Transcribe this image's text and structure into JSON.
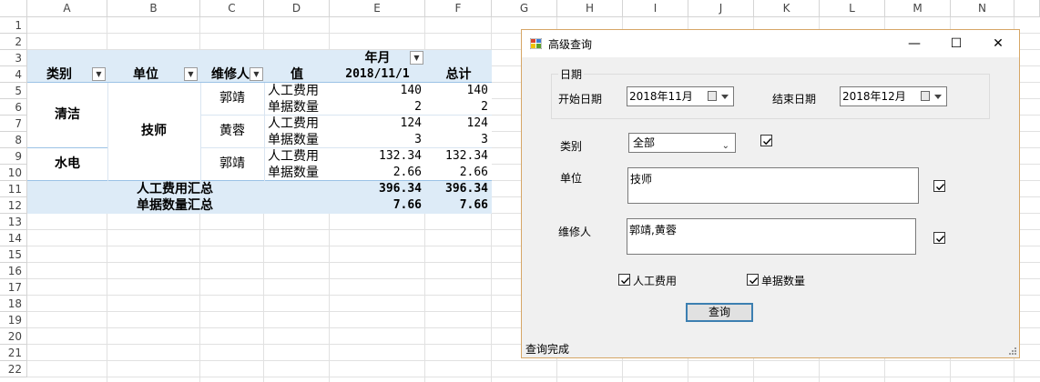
{
  "sheet": {
    "columns": [
      "A",
      "B",
      "C",
      "D",
      "E",
      "F",
      "G",
      "H",
      "I",
      "J",
      "K",
      "L",
      "M",
      "N"
    ],
    "rows": [
      "1",
      "2",
      "3",
      "4",
      "5",
      "6",
      "7",
      "8",
      "9",
      "10",
      "11",
      "12",
      "13",
      "14",
      "15",
      "16",
      "17",
      "18",
      "19",
      "20",
      "21",
      "22"
    ]
  },
  "pivot": {
    "header_month": "年月",
    "header_category": "类别",
    "header_unit": "单位",
    "header_repair": "维修人",
    "header_value": "值",
    "header_date": "2018/11/1",
    "header_total": "总计",
    "cat_clean": "清洁",
    "cat_water": "水电",
    "unit_tech": "技师",
    "person_guojing_1": "郭靖",
    "person_huangrong": "黄蓉",
    "person_guojing_2": "郭靖",
    "rows": [
      {
        "measure": "人工费用",
        "e": "140",
        "f": "140"
      },
      {
        "measure": "单据数量",
        "e": "2",
        "f": "2"
      },
      {
        "measure": "人工费用",
        "e": "124",
        "f": "124"
      },
      {
        "measure": "单据数量",
        "e": "3",
        "f": "3"
      },
      {
        "measure": "人工费用",
        "e": "132.34",
        "f": "132.34"
      },
      {
        "measure": "单据数量",
        "e": "2.66",
        "f": "2.66"
      }
    ],
    "sum_labor_label": "人工费用汇总",
    "sum_labor_e": "396.34",
    "sum_labor_f": "396.34",
    "sum_count_label": "单据数量汇总",
    "sum_count_e": "7.66",
    "sum_count_f": "7.66"
  },
  "dialog": {
    "title": "高级查询",
    "group_label": "日期",
    "start_label": "开始日期",
    "start_value": "2018年11月",
    "end_label": "结束日期",
    "end_value": "2018年12月",
    "category_label": "类别",
    "category_value": "全部",
    "unit_label": "单位",
    "unit_value": "技师",
    "repair_label": "维修人",
    "repair_value": "郭靖,黄蓉",
    "labor_check_label": "人工费用",
    "count_check_label": "单据数量",
    "query_button": "查询",
    "status": "查询完成",
    "minimize": "—",
    "maximize": "☐",
    "close": "✕"
  },
  "icons": [
    "app-icon",
    "calendar-icon",
    "dropdown-arrow-icon",
    "chevron-down-icon",
    "checkmark-icon",
    "filter-dropdown-icon",
    "resize-grip-icon"
  ]
}
